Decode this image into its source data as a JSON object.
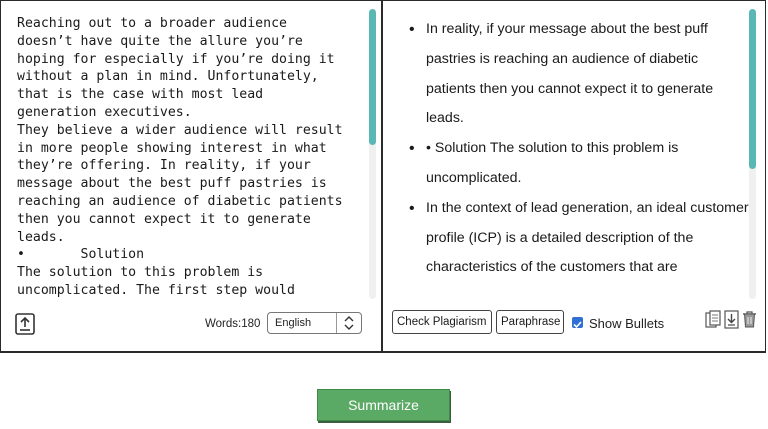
{
  "input_panel": {
    "text": "Reaching out to a broader audience\ndoesn’t have quite the allure you’re\nhoping for especially if you’re doing it\nwithout a plan in mind. Unfortunately,\nthat is the case with most lead\ngeneration executives.\nThey believe a wider audience will result\nin more people showing interest in what\nthey’re offering. In reality, if your\nmessage about the best puff pastries is\nreaching an audience of diabetic patients\nthen you cannot expect it to generate\nleads.\n•       Solution\nThe solution to this problem is\nuncomplicated. The first step would",
    "word_count_label": "Words:180",
    "language_selected": "English"
  },
  "output_panel": {
    "bullets": [
      "In reality, if your message about the best puff pastries is reaching an audience of diabetic patients then you cannot expect it to generate leads.",
      "• Solution The solution to this problem is uncomplicated.",
      "In the context of lead generation, an ideal customer profile (ICP) is a detailed description of the characteristics of the customers that are"
    ],
    "check_plagiarism_label": "Check Plagiarism",
    "paraphrase_label": "Paraphrase",
    "show_bullets_label": "Show Bullets",
    "show_bullets_checked": true
  },
  "summarize_label": "Summarize",
  "colors": {
    "accent_scroll": "#5ab8b4",
    "summarize_green": "#5aa964",
    "checkbox_blue": "#2f6fd6"
  },
  "icons": [
    "upload-icon",
    "chevron-updown-icon",
    "copy-icon",
    "download-icon",
    "trash-icon"
  ]
}
